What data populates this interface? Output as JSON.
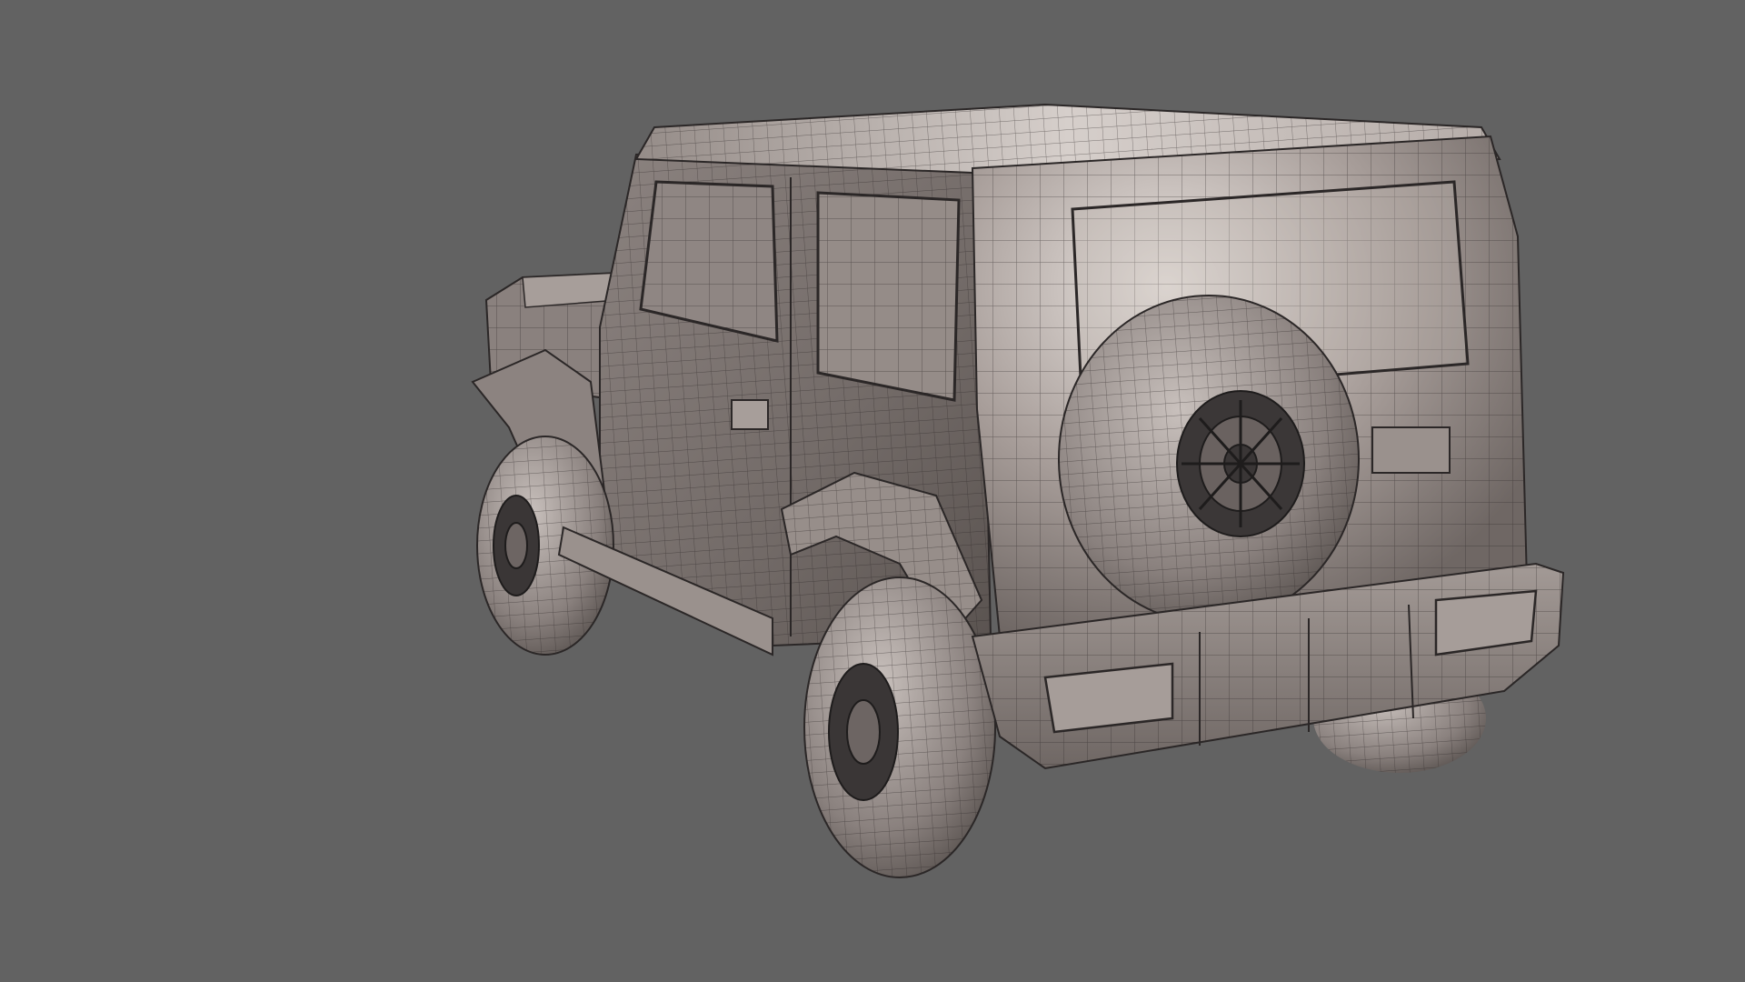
{
  "scene": {
    "subject": "suv-wireframe-model",
    "background_color": "#626262",
    "body_color": "#8f8683",
    "body_light": "#d2cbc7",
    "body_shadow": "#5e5754",
    "tire_color": "#7a7270",
    "rim_color": "#2c2a2a",
    "wire_color": "#2b2727"
  }
}
